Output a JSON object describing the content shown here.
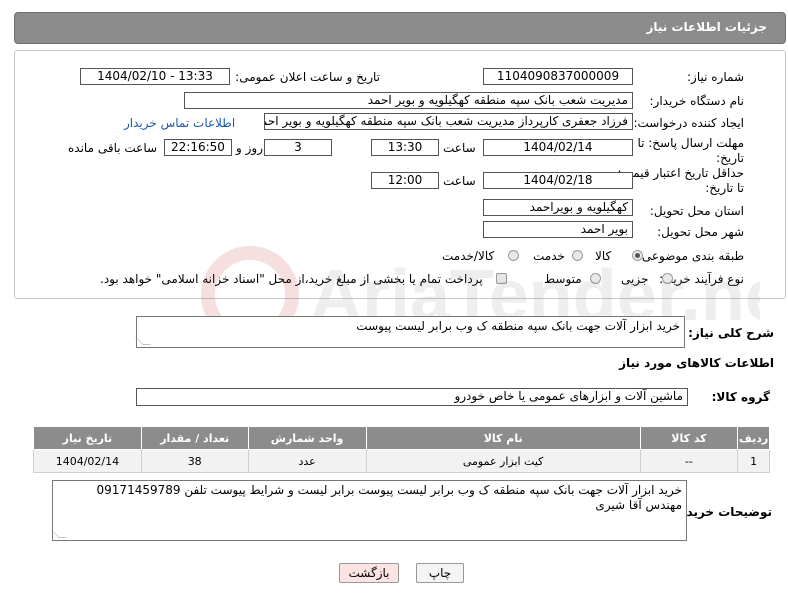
{
  "header": {
    "title": "جزئیات اطلاعات نیاز"
  },
  "form": {
    "need_number": {
      "label": "شماره نیاز:",
      "value": "1104090837000009"
    },
    "announce_datetime": {
      "label": "تاریخ و ساعت اعلان عمومی:",
      "value": "1404/02/10 - 13:33"
    },
    "buyer_org": {
      "label": "نام دستگاه خریدار:",
      "value": "مدیریت شعب بانک سپه منطقه کهگیلویه و بویر احمد"
    },
    "requester": {
      "label": "ایجاد کننده درخواست:",
      "value": "فرزاد جعفری کارپرداز مدیریت شعب بانک سپه منطقه کهگیلویه و بویر احمد",
      "contact_link": "اطلاعات تماس خریدار"
    },
    "reply_deadline": {
      "label_line1": "مهلت ارسال پاسخ: تا",
      "label_line2": "تاریخ:",
      "date": "1404/02/14",
      "time_label": "ساعت",
      "time": "13:30",
      "days": "3",
      "days_label": "روز و",
      "remaining": "22:16:50",
      "remaining_label": "ساعت باقی مانده"
    },
    "price_validity": {
      "label_line1": "حداقل تاریخ اعتبار قیمت:",
      "label_line2": "تا تاریخ:",
      "date": "1404/02/18",
      "time_label": "ساعت",
      "time": "12:00"
    },
    "delivery_province": {
      "label": "استان محل تحویل:",
      "value": "کهگیلویه و بویراحمد"
    },
    "delivery_city": {
      "label": "شهر محل تحویل:",
      "value": "بویر احمد"
    },
    "category": {
      "label": "طبقه بندی موضوعی:",
      "options": [
        "کالا",
        "خدمت",
        "کالا/خدمت"
      ],
      "selected": "کالا"
    },
    "process_type": {
      "label": "نوع فرآیند خرید :",
      "options": [
        "جزیی",
        "متوسط"
      ],
      "payment_note": "پرداخت تمام یا بخشی از مبلغ خرید،از محل \"اسناد خزانه اسلامی\" خواهد بود."
    }
  },
  "description": {
    "label": "شرح کلی نیاز:",
    "value": "خرید ابزار آلات جهت بانک سپه منطقه ک وب برابر لیست پیوست"
  },
  "goods_section": {
    "title": "اطلاعات کالاهای مورد نیاز",
    "group_label": "گروه کالا:",
    "group_value": "ماشین آلات و ابزارهای عمومی یا خاص خودرو"
  },
  "table": {
    "headers": [
      "ردیف",
      "کد کالا",
      "نام کالا",
      "واحد شمارش",
      "تعداد / مقدار",
      "تاریخ نیاز"
    ],
    "rows": [
      [
        "1",
        "--",
        "کیت ابزار عمومی",
        "عدد",
        "38",
        "1404/02/14"
      ]
    ]
  },
  "buyer_notes": {
    "label": "توضیحات خریدار:",
    "line1": "خرید ابزار آلات جهت بانک سپه منطقه ک وب برابر لیست پیوست برابر لیست و شرایط پیوست تلفن 09171459789",
    "line2": "مهندس آقا شیری"
  },
  "buttons": {
    "print": "چاپ",
    "back": "بازگشت"
  },
  "colors": {
    "header_bg": "#8c8c8c",
    "link": "#1a5aa8",
    "back_button_bg": "#fbe3e3"
  },
  "watermark": {
    "text": "AriaTender.net"
  }
}
